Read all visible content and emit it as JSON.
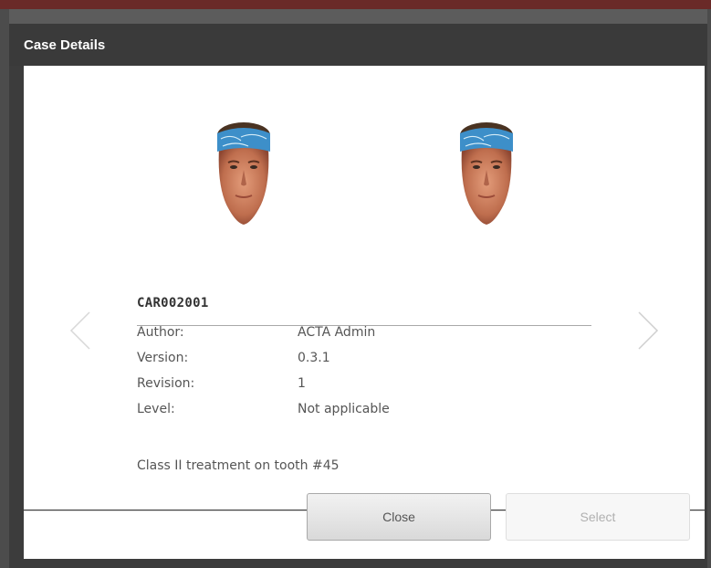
{
  "dialog": {
    "title": "Case Details",
    "case_id": "CAR002001",
    "fields": [
      {
        "label": "Author:",
        "value": "ACTA Admin"
      },
      {
        "label": "Version:",
        "value": "0.3.1"
      },
      {
        "label": "Revision:",
        "value": "1"
      },
      {
        "label": "Level:",
        "value": "Not applicable"
      }
    ],
    "description": "Class II treatment on tooth #45",
    "buttons": {
      "close": "Close",
      "select": "Select"
    }
  },
  "icons": {
    "prev": "chevron-left-icon",
    "next": "chevron-right-icon"
  },
  "colors": {
    "header": "#3a3a3a",
    "bandana": "#3d8fc9",
    "skin": "#c27a5a"
  }
}
